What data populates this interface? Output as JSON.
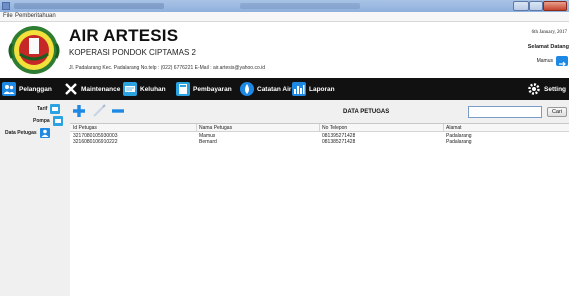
{
  "window": {
    "title": "",
    "menu": [
      "File",
      "Pemberitahuan"
    ]
  },
  "header": {
    "title": "AIR ARTESIS",
    "subtitle": "KOPERASI PONDOK CIPTAMAS 2",
    "address": "Jl. Padalarang Kec. Padalarang No.telp : (022) 6776221 E-Mail : air.artesis@yahoo.co.id",
    "date": "6th January, 2017",
    "welcome": "Selamat Datang",
    "user": "Mamus"
  },
  "toolbar": {
    "items": [
      {
        "label": "Pelanggan",
        "icon": "users-icon"
      },
      {
        "label": "Maintenance",
        "icon": "wrench-icon"
      },
      {
        "label": "Keluhan",
        "icon": "complaint-icon"
      },
      {
        "label": "Pembayaran",
        "icon": "calculator-icon"
      },
      {
        "label": "Catatan Air",
        "icon": "water-drop-icon"
      },
      {
        "label": "Laporan",
        "icon": "report-chart-icon"
      }
    ],
    "setting": {
      "label": "Setting",
      "icon": "gear-icon"
    }
  },
  "sidebar": {
    "items": [
      {
        "label": "Tarif",
        "icon": "tariff-icon"
      },
      {
        "label": "Pompa",
        "icon": "pump-icon"
      },
      {
        "label": "Data Petugas",
        "icon": "staff-icon"
      }
    ]
  },
  "content": {
    "title": "DATA PETUGAS",
    "search_value": "",
    "search_button": "Cari",
    "actions": [
      "add-icon",
      "edit-icon",
      "delete-icon"
    ],
    "table": {
      "columns": [
        "Id Petugas",
        "Nama Petugas",
        "No Telepon",
        "Alamat"
      ],
      "rows": [
        [
          "3217080105930003",
          "Mamus",
          "081395271428",
          "Padalarang"
        ],
        [
          "3216080106910222",
          "Bernard",
          "081385271428",
          "Padalarang"
        ]
      ]
    }
  },
  "colors": {
    "toolbar_bg": "#111111",
    "accent_blue": "#1e88e5",
    "title_bar": "#a9c3e6"
  }
}
